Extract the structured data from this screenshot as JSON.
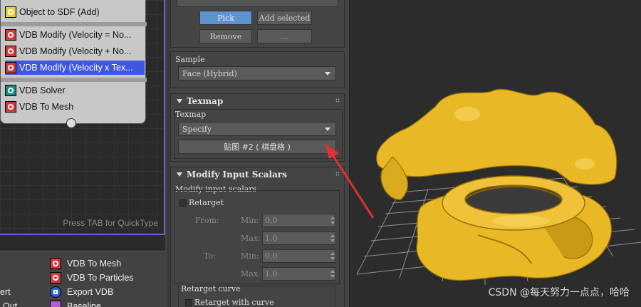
{
  "node_editor": {
    "items": [
      {
        "label": "Object to SDF (Add)",
        "icon": "object-to-sdf-icon"
      },
      {
        "label": "VDB Modify (Velocity = No...",
        "icon": "vdb-modify-icon"
      },
      {
        "label": "VDB Modify (Velocity + No...",
        "icon": "vdb-modify-icon"
      },
      {
        "label": "VDB Modify (Velocity x Tex...",
        "icon": "vdb-modify-icon"
      },
      {
        "label": "VDB Solver",
        "icon": "vdb-solver-icon"
      },
      {
        "label": "VDB To Mesh",
        "icon": "vdb-to-mesh-icon"
      }
    ],
    "hint": "Press TAB for QuickType"
  },
  "operator_list": {
    "items": [
      {
        "label": "VDB To Mesh",
        "icon": "vdb-to-mesh-icon"
      },
      {
        "label": "VDB To Particles",
        "icon": "vdb-to-particles-icon"
      },
      {
        "label": "Export VDB",
        "icon": "export-vdb-icon"
      },
      {
        "label": "Baseline",
        "icon": "baseline-icon"
      }
    ],
    "cut_labels": [
      "ert",
      "Out"
    ]
  },
  "panel": {
    "pick_label": "Pick",
    "add_selected_label": "Add selected",
    "remove_label": "Remove",
    "more_label": "...",
    "sample_label": "Sample",
    "sample_value": "Face (Hybrid)",
    "texmap_rollout": "Texmap",
    "texmap_label": "Texmap",
    "texmap_mode": "Specify",
    "texmap_button": "贴图 #2 ( 棋盘格 )",
    "modify_rollout": "Modify Input Scalars",
    "modify_label": "Modify input scalars",
    "retarget_label": "Retarget",
    "from_label": "From:",
    "to_label": "To:",
    "min_label": "Min:",
    "max_label": "Max:",
    "from_min": "0.0",
    "from_max": "1.0",
    "to_min": "0.0",
    "to_max": "1.0",
    "retarget_curve_label": "Retarget curve",
    "retarget_with_curve_label": "Retarget with curve"
  },
  "viewport": {
    "watermark": "CSDN @每天努力一点点，哈哈",
    "mesh_color": "#e8b827",
    "arrow_color": "#e03030"
  }
}
